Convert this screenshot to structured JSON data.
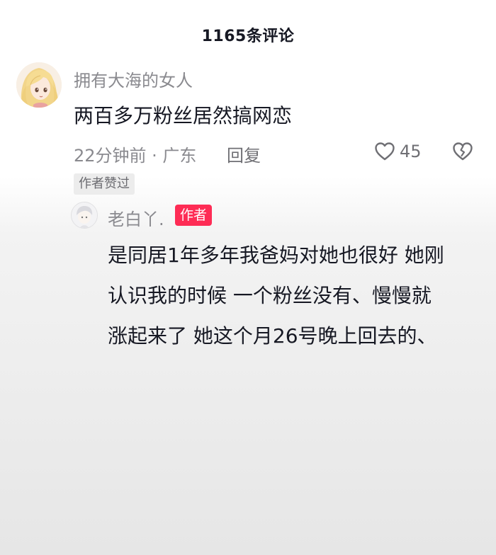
{
  "header": {
    "title": "1165条评论"
  },
  "comment": {
    "username": "拥有大海的女人",
    "text": "两百多万粉丝居然搞网恋",
    "meta": "22分钟前 · 广东",
    "reply_label": "回复",
    "like_count": "45",
    "author_liked_badge": "作者赞过",
    "like_icon": "heart-outline-icon",
    "dislike_icon": "broken-heart-icon"
  },
  "reply": {
    "username": "老白丫.",
    "author_tag": "作者",
    "lines": [
      "是同居1年多年我爸妈对她也很好 她刚",
      "认识我的时候  一个粉丝没有、慢慢就",
      "涨起来了 她这个月26号晚上回去的、"
    ]
  },
  "colors": {
    "author_tag": "#fe2c55",
    "secondary_text": "#8a8a8f",
    "primary_text": "#161823"
  }
}
